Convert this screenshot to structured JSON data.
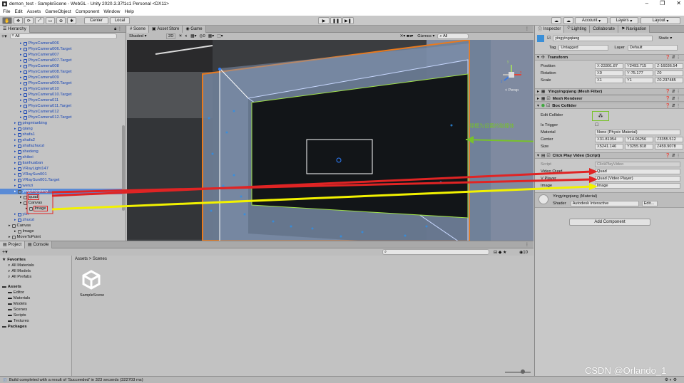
{
  "window": {
    "title": "demon_test - SampleScene - WebGL - Unity 2020.3.37f1c1 Personal <DX11>"
  },
  "menu": [
    "File",
    "Edit",
    "Assets",
    "GameObject",
    "Component",
    "Window",
    "Help"
  ],
  "toolbar": {
    "center": "Center",
    "local": "Local",
    "account": "Account",
    "layers": "Layers",
    "layout": "Layout"
  },
  "hierarchy": {
    "tab": "Hierarchy",
    "search_placeholder": "All",
    "items": [
      {
        "label": "PhysCamera006",
        "indent": 3,
        "blue": true
      },
      {
        "label": "PhysCamera006.Target",
        "indent": 3,
        "blue": true
      },
      {
        "label": "PhysCamera007",
        "indent": 3,
        "blue": true
      },
      {
        "label": "PhysCamera007.Target",
        "indent": 3,
        "blue": true
      },
      {
        "label": "PhysCamera008",
        "indent": 3,
        "blue": true
      },
      {
        "label": "PhysCamera008.Target",
        "indent": 3,
        "blue": true
      },
      {
        "label": "PhysCamera009",
        "indent": 3,
        "blue": true
      },
      {
        "label": "PhysCamera009.Target",
        "indent": 3,
        "blue": true
      },
      {
        "label": "PhysCamera010",
        "indent": 3,
        "blue": true
      },
      {
        "label": "PhysCamera010.Target",
        "indent": 3,
        "blue": true
      },
      {
        "label": "PhysCamera011",
        "indent": 3,
        "blue": true
      },
      {
        "label": "PhysCamera011.Target",
        "indent": 3,
        "blue": true
      },
      {
        "label": "PhysCamera012",
        "indent": 3,
        "blue": true
      },
      {
        "label": "PhysCamera012.Target",
        "indent": 3,
        "blue": true
      },
      {
        "label": "pingmianbing",
        "indent": 2,
        "blue": true
      },
      {
        "label": "qiang",
        "indent": 2,
        "blue": true
      },
      {
        "label": "shafa1",
        "indent": 2,
        "blue": true
      },
      {
        "label": "shafa2",
        "indent": 2,
        "blue": true
      },
      {
        "label": "shafazhuozi",
        "indent": 2,
        "blue": true
      },
      {
        "label": "shedeng",
        "indent": 2,
        "blue": true
      },
      {
        "label": "shibei",
        "indent": 2,
        "blue": true
      },
      {
        "label": "tianhuaban",
        "indent": 2,
        "blue": true
      },
      {
        "label": "VRayLight147",
        "indent": 2,
        "blue": true
      },
      {
        "label": "VRaySun001",
        "indent": 2,
        "blue": true
      },
      {
        "label": "VRaySun001.Target",
        "indent": 2,
        "blue": true
      },
      {
        "label": "wenzi",
        "indent": 2,
        "blue": true
      },
      {
        "label": "yingyingqiang",
        "indent": 2,
        "blue": false,
        "selected": true
      },
      {
        "label": "quad",
        "indent": 3,
        "blue": false,
        "boxed": true
      },
      {
        "label": "Canvas",
        "indent": 3,
        "blue": false
      },
      {
        "label": "Image",
        "indent": 4,
        "blue": false,
        "boxed": true
      },
      {
        "label": "yizi",
        "indent": 2,
        "blue": true
      },
      {
        "label": "zhuozi",
        "indent": 2,
        "blue": true
      },
      {
        "label": "Canvas",
        "indent": 1,
        "blue": false
      },
      {
        "label": "Image",
        "indent": 2,
        "blue": false
      },
      {
        "label": "MoveToPoint",
        "indent": 1,
        "blue": false
      }
    ]
  },
  "scene": {
    "tabs": [
      "Scene",
      "Asset Store",
      "Game"
    ],
    "shading": "Shaded",
    "mode_2d": "2D",
    "gizmos": "Gizmos",
    "search_placeholder": "All",
    "persp": "< Persp",
    "axes": {
      "x": "x",
      "y": "y",
      "z": "z"
    },
    "annotation": "绿框为设置的碰撞体"
  },
  "inspector": {
    "tabs": [
      "Inspector",
      "Lighting",
      "Collaborate",
      "Navigation"
    ],
    "object_name": "yingyingqiang",
    "static_label": "Static",
    "tag_label": "Tag",
    "tag_value": "Untagged",
    "layer_label": "Layer",
    "layer_value": "Default",
    "transform": {
      "title": "Transform",
      "position": {
        "label": "Position",
        "x": "-23301.87",
        "y": "2493.715",
        "z": "-16036.54"
      },
      "rotation": {
        "label": "Rotation",
        "x": "0",
        "y": "-75.177",
        "z": "0"
      },
      "scale": {
        "label": "Scale",
        "x": "1",
        "y": "1",
        "z": "0.237485"
      }
    },
    "mesh_filter": "Yingyingqiang (Mesh Filter)",
    "mesh_renderer": "Mesh Renderer",
    "box_collider": {
      "title": "Box Collider",
      "edit_collider": "Edit Collider",
      "is_trigger": "Is Trigger",
      "material_label": "Material",
      "material_value": "None (Physic Material)",
      "center": {
        "label": "Center",
        "x": "31.81054",
        "y": "14.06256",
        "z": "3355.512"
      },
      "size": {
        "label": "Size",
        "x": "5241.146",
        "y": "3255.818",
        "z": "459.9078"
      }
    },
    "script": {
      "title": "Click Play Video (Script)",
      "script_label": "Script",
      "script_value": "ClickPlayVideo",
      "video_quad_label": "Video Quad",
      "video_quad_value": "Quad",
      "player_label": "V Player",
      "player_value": "Quad (Video Player)",
      "image_label": "Image",
      "image_value": "Image"
    },
    "material": {
      "name": "Yingyingqiang (Material)",
      "shader_label": "Shader",
      "shader_value": "Autodesk Interactive",
      "edit": "Edit..."
    },
    "add_component": "Add Component"
  },
  "project": {
    "tabs": [
      "Project",
      "Console"
    ],
    "favorites_label": "Favorites",
    "favorites": [
      "All Materials",
      "All Models",
      "All Prefabs"
    ],
    "assets_label": "Assets",
    "folders": [
      "Editor",
      "Materials",
      "Models",
      "Scenes",
      "Scripts",
      "Textures"
    ],
    "packages_label": "Packages",
    "breadcrumb": "Assets > Scenes",
    "asset_name": "SampleScene",
    "count": "10"
  },
  "status": "Build completed with a result of 'Succeeded' in 323 seconds (322703 ms)",
  "watermark": "CSDN @Orlando_1",
  "colors": {
    "selected_row": "#5a8bd6",
    "orange": "#e87a1e",
    "green": "#78c22a",
    "red": "#e02424",
    "yellow": "#f2f200"
  }
}
